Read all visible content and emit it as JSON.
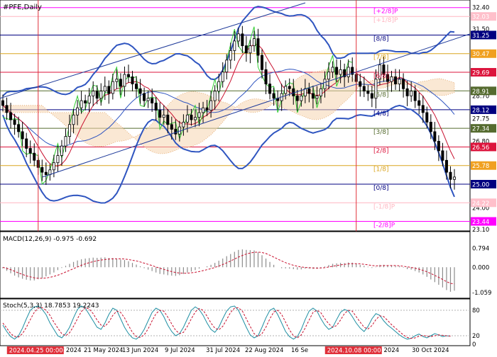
{
  "chart_data": [
    {
      "type": "candlestick",
      "title": "#PFE,Daily",
      "symbol": "#PFE",
      "timeframe": "Daily",
      "ylim": [
        23.1,
        32.6
      ],
      "y_ticks": [
        32.4,
        31.5,
        30.47,
        29.69,
        28.7,
        27.75,
        26.8,
        25.78,
        25.0,
        24.0,
        23.1
      ],
      "x_ticks": [
        "24 Apr 2024",
        "24 Apr 2024",
        "21 May 2024",
        "13 Jun 2024",
        "9 Jul 2024",
        "31 Jul 2024",
        "22 Aug 2024",
        "16 Sep 2024",
        "8 Oct 2024",
        "30 Oct 2024"
      ],
      "price_levels": [
        {
          "label": "[+2/8]P",
          "value": 32.4,
          "color": "#ff00ff"
        },
        {
          "label": "[+1/8]P",
          "value": 32.03,
          "color": "#ffb6c1"
        },
        {
          "label": "[8/8]",
          "value": 31.25,
          "color": "#000080"
        },
        {
          "label": "[7/8]",
          "value": 30.47,
          "color": "#daa520"
        },
        {
          "label": "[6/8]",
          "value": 29.69,
          "color": "#dc143c"
        },
        {
          "label": "[5/8]",
          "value": 28.91,
          "color": "#556b2f"
        },
        {
          "label": "[4/8]",
          "value": 28.12,
          "color": "#000080"
        },
        {
          "label": "[3/8]",
          "value": 27.34,
          "color": "#556b2f"
        },
        {
          "label": "[2/8]",
          "value": 26.56,
          "color": "#dc143c"
        },
        {
          "label": "[1/8]",
          "value": 25.78,
          "color": "#daa520"
        },
        {
          "label": "[0/8]",
          "value": 25.0,
          "color": "#000080"
        },
        {
          "label": "[-1/8]P",
          "value": 24.22,
          "color": "#ffb6c1"
        },
        {
          "label": "[-2/8]P",
          "value": 23.44,
          "color": "#ff00ff"
        }
      ],
      "price_badges": [
        {
          "text": "32.03",
          "value": 32.03,
          "color": "#ffc0cb"
        },
        {
          "text": "31.25",
          "value": 31.25,
          "color": "#000080"
        },
        {
          "text": "30.47",
          "value": 30.47,
          "color": "#f0a020"
        },
        {
          "text": "29.69",
          "value": 29.69,
          "color": "#dc143c"
        },
        {
          "text": "28.91",
          "value": 28.91,
          "color": "#556b2f"
        },
        {
          "text": "28.12",
          "value": 28.12,
          "color": "#000080"
        },
        {
          "text": "27.34",
          "value": 27.34,
          "color": "#556b2f"
        },
        {
          "text": "26.56",
          "value": 26.56,
          "color": "#dc143c"
        },
        {
          "text": "25.78",
          "value": 25.78,
          "color": "#f0a020"
        },
        {
          "text": "25.00",
          "value": 25.0,
          "color": "#000080"
        },
        {
          "text": "24.22",
          "value": 24.22,
          "color": "#ffc0cb"
        },
        {
          "text": "23.44",
          "value": 23.44,
          "color": "#ff00ff"
        }
      ],
      "vertical_markers": [
        "2024.04.25 00:00",
        "2024.10.08 00:00"
      ],
      "indicators": [
        "Bollinger Bands",
        "Moving Average",
        "Ichimoku Cloud",
        "Chikou Span",
        "Murrey Math Lines"
      ],
      "closing_prices": [
        28.3,
        28.0,
        27.7,
        27.5,
        27.2,
        26.9,
        26.5,
        26.3,
        26.0,
        25.7,
        25.5,
        25.4,
        25.6,
        25.9,
        26.2,
        26.6,
        27.0,
        27.5,
        27.9,
        28.2,
        28.5,
        28.4,
        28.7,
        28.9,
        28.6,
        28.9,
        29.1,
        28.8,
        29.3,
        29.4,
        29.1,
        29.6,
        29.5,
        29.2,
        29.0,
        28.8,
        28.5,
        28.6,
        28.4,
        28.1,
        27.8,
        27.9,
        27.5,
        27.3,
        27.1,
        27.4,
        27.6,
        27.9,
        27.7,
        27.8,
        28.0,
        28.2,
        28.1,
        28.5,
        28.9,
        29.3,
        29.7,
        30.2,
        30.6,
        31.0,
        31.3,
        30.8,
        30.5,
        30.8,
        31.1,
        30.4,
        29.8,
        29.2,
        28.8,
        28.6,
        28.5,
        28.8,
        29.1,
        29.0,
        28.7,
        28.5,
        28.7,
        29.0,
        28.8,
        28.6,
        28.7,
        29.0,
        29.4,
        29.7,
        29.9,
        29.6,
        29.8,
        29.5,
        29.9,
        29.6,
        29.3,
        29.1,
        28.9,
        28.8,
        28.6,
        29.4,
        30.0,
        29.6,
        29.3,
        29.5,
        29.2,
        29.4,
        29.0,
        28.7,
        28.9,
        28.5,
        28.3,
        28.0,
        27.6,
        27.2,
        26.8,
        26.4,
        26.0,
        25.5,
        25.2,
        25.3
      ],
      "series": [
        {
          "name": "MACD(12,26,9)"
        },
        {
          "name": "Stoch(5,3,3)"
        }
      ]
    },
    {
      "type": "bar",
      "title": "MACD(12,26,9) -0.975 -0.692",
      "indicator": "MACD(12,26,9)",
      "values_label": "-0.975 -0.692",
      "ylim": [
        -1.2,
        0.95
      ],
      "y_ticks": [
        0.794,
        0.0,
        -1.059
      ],
      "histogram": [
        -0.05,
        -0.15,
        -0.25,
        -0.35,
        -0.42,
        -0.48,
        -0.52,
        -0.55,
        -0.55,
        -0.5,
        -0.45,
        -0.38,
        -0.3,
        -0.22,
        -0.12,
        -0.03,
        0.06,
        0.14,
        0.22,
        0.28,
        0.33,
        0.36,
        0.38,
        0.4,
        0.39,
        0.4,
        0.41,
        0.38,
        0.38,
        0.36,
        0.32,
        0.3,
        0.25,
        0.18,
        0.11,
        0.04,
        -0.04,
        -0.1,
        -0.16,
        -0.22,
        -0.28,
        -0.3,
        -0.33,
        -0.35,
        -0.36,
        -0.33,
        -0.28,
        -0.22,
        -0.18,
        -0.12,
        -0.06,
        0.0,
        0.04,
        0.1,
        0.18,
        0.27,
        0.36,
        0.46,
        0.55,
        0.64,
        0.72,
        0.74,
        0.72,
        0.71,
        0.7,
        0.62,
        0.5,
        0.36,
        0.22,
        0.1,
        0.0,
        -0.04,
        -0.05,
        -0.06,
        -0.08,
        -0.1,
        -0.09,
        -0.06,
        -0.06,
        -0.07,
        -0.06,
        -0.03,
        0.03,
        0.09,
        0.14,
        0.16,
        0.18,
        0.17,
        0.2,
        0.19,
        0.15,
        0.1,
        0.06,
        0.02,
        -0.03,
        0.02,
        0.1,
        0.1,
        0.08,
        0.08,
        0.05,
        0.04,
        -0.02,
        -0.08,
        -0.1,
        -0.16,
        -0.22,
        -0.3,
        -0.4,
        -0.51,
        -0.62,
        -0.73,
        -0.84,
        -0.95,
        -1.02,
        -0.975
      ],
      "signal": [
        0.0,
        -0.05,
        -0.1,
        -0.17,
        -0.24,
        -0.3,
        -0.36,
        -0.4,
        -0.44,
        -0.46,
        -0.46,
        -0.45,
        -0.42,
        -0.38,
        -0.33,
        -0.27,
        -0.2,
        -0.13,
        -0.06,
        0.01,
        0.08,
        0.14,
        0.19,
        0.23,
        0.27,
        0.3,
        0.32,
        0.34,
        0.35,
        0.35,
        0.35,
        0.34,
        0.32,
        0.29,
        0.26,
        0.22,
        0.17,
        0.12,
        0.07,
        0.01,
        -0.04,
        -0.09,
        -0.14,
        -0.18,
        -0.22,
        -0.24,
        -0.25,
        -0.25,
        -0.23,
        -0.21,
        -0.18,
        -0.14,
        -0.1,
        -0.06,
        -0.01,
        0.05,
        0.11,
        0.18,
        0.26,
        0.34,
        0.42,
        0.49,
        0.55,
        0.59,
        0.62,
        0.63,
        0.61,
        0.57,
        0.5,
        0.42,
        0.34,
        0.26,
        0.19,
        0.13,
        0.08,
        0.04,
        0.01,
        -0.01,
        -0.02,
        -0.03,
        -0.04,
        -0.03,
        -0.02,
        0.01,
        0.04,
        0.07,
        0.1,
        0.12,
        0.14,
        0.15,
        0.15,
        0.14,
        0.12,
        0.1,
        0.07,
        0.06,
        0.06,
        0.07,
        0.07,
        0.07,
        0.07,
        0.06,
        0.04,
        0.02,
        -0.01,
        -0.04,
        -0.08,
        -0.13,
        -0.19,
        -0.26,
        -0.34,
        -0.42,
        -0.51,
        -0.6,
        -0.67,
        -0.692
      ]
    },
    {
      "type": "line",
      "title": "Stoch(5,3,3) 18.7853 19.2243",
      "indicator": "Stoch(5,3,3)",
      "values_label": "18.7853 19.2243",
      "ylim": [
        0,
        100
      ],
      "y_ticks": [
        80,
        20,
        0
      ],
      "levels": [
        80,
        20
      ],
      "main": [
        45,
        30,
        18,
        12,
        20,
        38,
        60,
        80,
        88,
        90,
        82,
        70,
        50,
        35,
        20,
        15,
        25,
        40,
        62,
        82,
        90,
        85,
        70,
        55,
        40,
        35,
        50,
        70,
        85,
        80,
        60,
        40,
        25,
        15,
        12,
        20,
        35,
        55,
        75,
        85,
        80,
        65,
        45,
        30,
        20,
        25,
        40,
        60,
        80,
        88,
        82,
        68,
        50,
        35,
        28,
        40,
        60,
        78,
        88,
        90,
        80,
        60,
        40,
        22,
        15,
        20,
        40,
        62,
        80,
        85,
        70,
        50,
        30,
        18,
        12,
        18,
        35,
        58,
        78,
        85,
        78,
        60,
        45,
        35,
        40,
        58,
        75,
        82,
        78,
        65,
        50,
        38,
        30,
        42,
        60,
        72,
        68,
        55,
        45,
        38,
        30,
        22,
        16,
        12,
        14,
        20,
        24,
        18,
        15,
        20,
        25,
        22,
        18,
        20,
        19
      ],
      "signal": [
        50,
        38,
        25,
        18,
        17,
        25,
        40,
        58,
        75,
        85,
        86,
        80,
        68,
        52,
        38,
        25,
        20,
        27,
        42,
        60,
        77,
        86,
        83,
        72,
        57,
        45,
        42,
        52,
        68,
        78,
        75,
        62,
        44,
        28,
        18,
        16,
        22,
        36,
        55,
        72,
        80,
        78,
        64,
        48,
        33,
        25,
        28,
        42,
        60,
        76,
        84,
        80,
        66,
        50,
        38,
        34,
        42,
        58,
        75,
        85,
        86,
        78,
        60,
        42,
        25,
        18,
        25,
        40,
        60,
        76,
        80,
        70,
        52,
        34,
        20,
        15,
        22,
        38,
        57,
        75,
        80,
        74,
        60,
        48,
        40,
        44,
        57,
        72,
        80,
        78,
        65,
        52,
        40,
        36,
        44,
        58,
        67,
        65,
        56,
        46,
        38,
        30,
        22,
        16,
        14,
        15,
        19,
        21,
        19,
        18,
        20,
        22,
        21,
        20,
        19.2
      ]
    }
  ],
  "footer": {
    "dates": [
      "24 Apr 2024",
      "24 Apr 2024",
      "21 May 2024",
      "13 Jun 2024",
      "9 Jul 2024",
      "31 Jul 2024",
      "22 Aug 2024",
      "16 Se",
      "8 Oct 2024",
      "30 Oct 2024"
    ],
    "cursor_labels": [
      "2024.04.25 00:00",
      "2024.10.08 00:00"
    ]
  }
}
